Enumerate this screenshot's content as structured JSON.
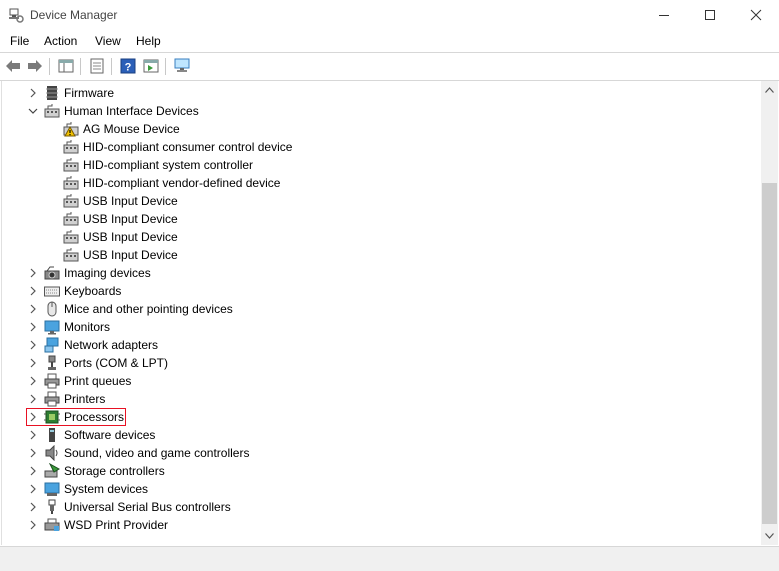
{
  "window": {
    "title": "Device Manager",
    "controls": [
      "minimize",
      "maximize",
      "close"
    ]
  },
  "menu": [
    "File",
    "Action",
    "View",
    "Help"
  ],
  "toolbar": {
    "buttons": [
      "back-icon",
      "forward-icon",
      "properties-pane-icon",
      "device-list-icon",
      "help-icon",
      "action-pane-icon",
      "scan-hardware-icon"
    ]
  },
  "tree": {
    "nodes": [
      {
        "label": "Firmware",
        "expanded": false,
        "level": 0,
        "icon": "firmware-icon"
      },
      {
        "label": "Human Interface Devices",
        "expanded": true,
        "level": 0,
        "icon": "hid-icon"
      },
      {
        "label": "AG Mouse Device",
        "level": 1,
        "icon": "hid-warning-icon"
      },
      {
        "label": "HID-compliant consumer control device",
        "level": 1,
        "icon": "hid-icon"
      },
      {
        "label": "HID-compliant system controller",
        "level": 1,
        "icon": "hid-icon"
      },
      {
        "label": "HID-compliant vendor-defined device",
        "level": 1,
        "icon": "hid-icon"
      },
      {
        "label": "USB Input Device",
        "level": 1,
        "icon": "hid-icon"
      },
      {
        "label": "USB Input Device",
        "level": 1,
        "icon": "hid-icon"
      },
      {
        "label": "USB Input Device",
        "level": 1,
        "icon": "hid-icon"
      },
      {
        "label": "USB Input Device",
        "level": 1,
        "icon": "hid-icon"
      },
      {
        "label": "Imaging devices",
        "expanded": false,
        "level": 0,
        "icon": "imaging-icon"
      },
      {
        "label": "Keyboards",
        "expanded": false,
        "level": 0,
        "icon": "keyboard-icon"
      },
      {
        "label": "Mice and other pointing devices",
        "expanded": false,
        "level": 0,
        "icon": "mouse-icon"
      },
      {
        "label": "Monitors",
        "expanded": false,
        "level": 0,
        "icon": "monitor-icon"
      },
      {
        "label": "Network adapters",
        "expanded": false,
        "level": 0,
        "icon": "network-icon"
      },
      {
        "label": "Ports (COM & LPT)",
        "expanded": false,
        "level": 0,
        "icon": "port-icon"
      },
      {
        "label": "Print queues",
        "expanded": false,
        "level": 0,
        "icon": "printer-icon"
      },
      {
        "label": "Printers",
        "expanded": false,
        "level": 0,
        "icon": "printer-icon"
      },
      {
        "label": "Processors",
        "expanded": false,
        "level": 0,
        "icon": "processor-icon",
        "highlighted": true
      },
      {
        "label": "Software devices",
        "expanded": false,
        "level": 0,
        "icon": "software-device-icon"
      },
      {
        "label": "Sound, video and game controllers",
        "expanded": false,
        "level": 0,
        "icon": "speaker-icon"
      },
      {
        "label": "Storage controllers",
        "expanded": false,
        "level": 0,
        "icon": "storage-icon"
      },
      {
        "label": "System devices",
        "expanded": false,
        "level": 0,
        "icon": "system-device-icon"
      },
      {
        "label": "Universal Serial Bus controllers",
        "expanded": false,
        "level": 0,
        "icon": "usb-icon"
      },
      {
        "label": "WSD Print Provider",
        "expanded": false,
        "level": 0,
        "icon": "wsd-icon"
      }
    ]
  },
  "colors": {
    "highlight_border": "#e81123",
    "scrollbar_track": "#f0f0f0",
    "scrollbar_thumb": "#cdcdcd"
  }
}
